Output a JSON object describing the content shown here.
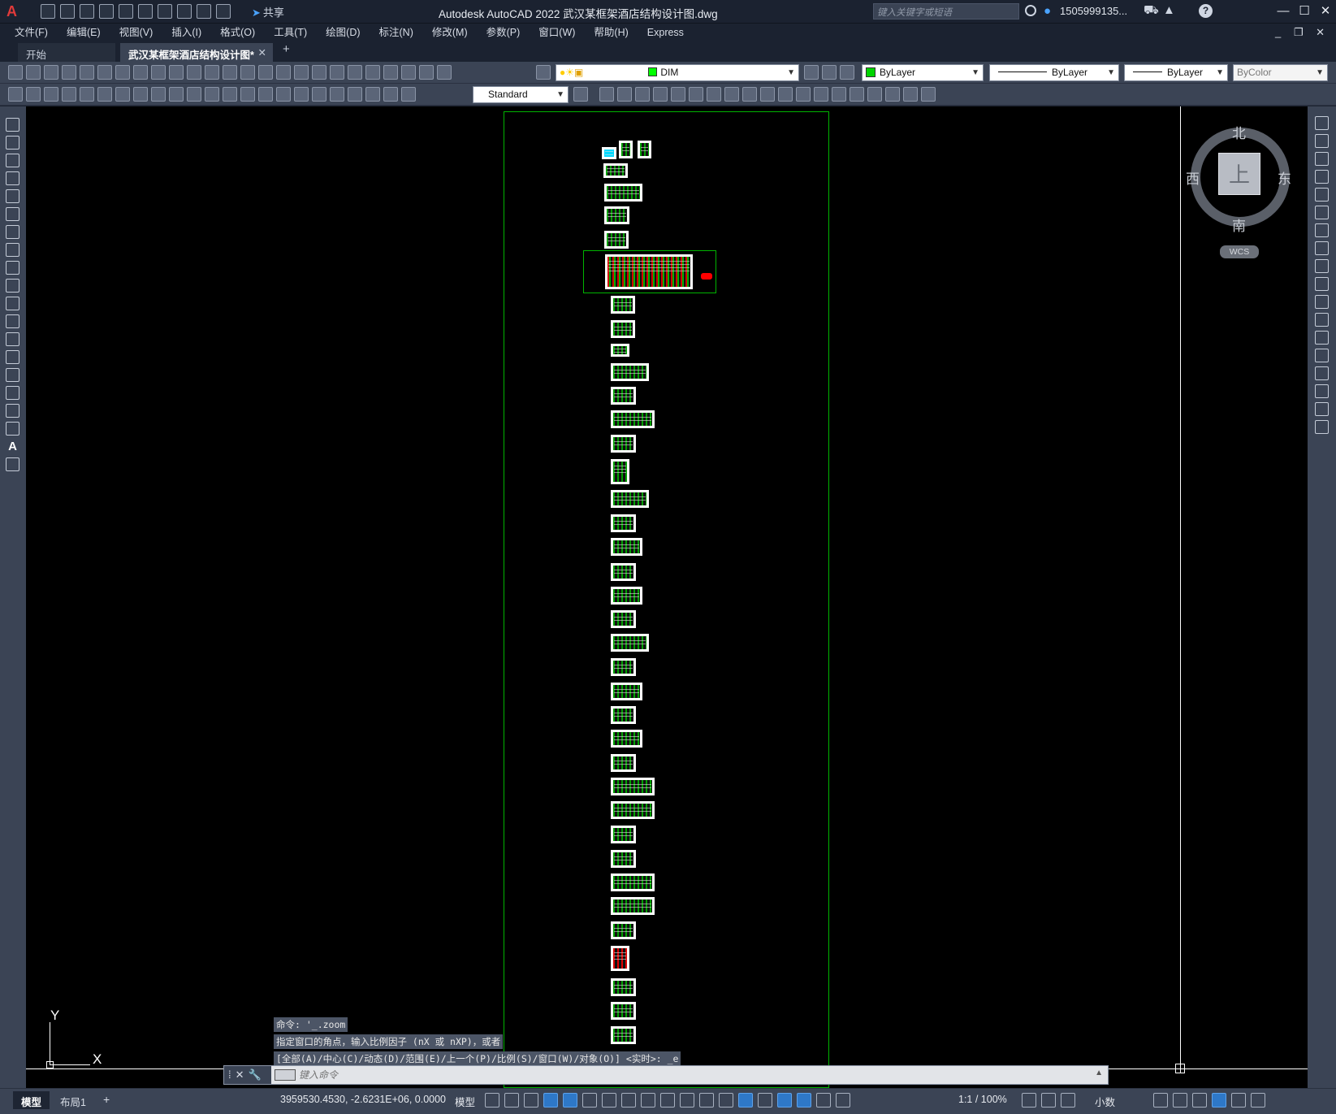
{
  "window": {
    "title": "Autodesk AutoCAD 2022    武汉某框架酒店结构设计图.dwg",
    "share_label": "共享",
    "search_placeholder": "键入关键字或短语",
    "user": "1505999135...",
    "controls": [
      "—",
      "☐",
      "✕"
    ]
  },
  "menu": {
    "items": [
      "文件(F)",
      "编辑(E)",
      "视图(V)",
      "插入(I)",
      "格式(O)",
      "工具(T)",
      "绘图(D)",
      "标注(N)",
      "修改(M)",
      "参数(P)",
      "窗口(W)",
      "帮助(H)",
      "Express"
    ]
  },
  "tabs": {
    "start": "开始",
    "active": "武汉某框架酒店结构设计图*"
  },
  "toolbar": {
    "layer": "DIM",
    "color": "ByLayer",
    "linetype": "ByLayer",
    "lineweight": "ByLayer",
    "plotstyle": "ByColor",
    "text_style": "Standard"
  },
  "viewcube": {
    "north": "北",
    "south": "南",
    "east": "东",
    "west": "西",
    "face": "上",
    "wcs": "WCS"
  },
  "ucs": {
    "x": "X",
    "y": "Y"
  },
  "command": {
    "history": [
      "命令: '_.zoom",
      "指定窗口的角点，输入比例因子 (nX 或 nXP)，或者",
      "[全部(A)/中心(C)/动态(D)/范围(E)/上一个(P)/比例(S)/窗口(W)/对象(O)] <实时>: _e"
    ],
    "placeholder": "键入命令"
  },
  "status": {
    "model_tab": "模型",
    "layout_tab": "布局1",
    "coordinates": "3959530.4530, -2.6231E+06, 0.0000",
    "space": "模型",
    "annotation_scale": "1:1 / 100%",
    "units": "小数"
  }
}
